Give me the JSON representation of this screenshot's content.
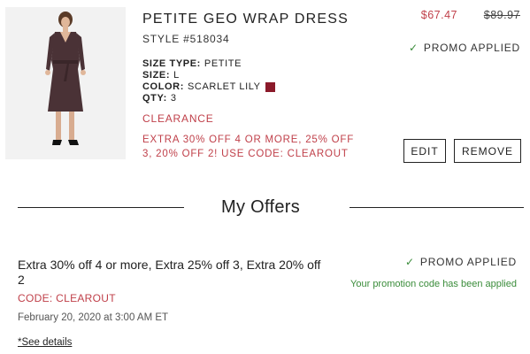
{
  "product": {
    "title": "PETITE GEO WRAP DRESS",
    "style": "STYLE #518034",
    "attributes": [
      {
        "key": "SIZE TYPE:",
        "value": "PETITE"
      },
      {
        "key": "SIZE:",
        "value": "L"
      },
      {
        "key": "COLOR:",
        "value": "SCARLET LILY"
      },
      {
        "key": "QTY:",
        "value": "3"
      }
    ],
    "color_swatch": "#8b1a2a",
    "clearance_label": "CLEARANCE",
    "promo_text": "EXTRA 30% OFF 4 OR MORE, 25% OFF 3, 20% OFF 2! USE CODE: CLEAROUT",
    "sale_price": "$67.47",
    "original_price": "$89.97",
    "promo_applied": "PROMO APPLIED",
    "edit_label": "EDIT",
    "remove_label": "REMOVE",
    "image_icon": "dress-photo"
  },
  "offers": {
    "section_title": "My Offers",
    "items": [
      {
        "description": "Extra 30% off 4 or more, Extra 25% off 3, Extra 20% off 2",
        "code": "CODE: CLEAROUT",
        "date": "February 20, 2020 at 3:00 AM ET",
        "see_details": "*See details",
        "status": "PROMO APPLIED",
        "status_message": "Your promotion code has been applied"
      }
    ]
  },
  "colors": {
    "accent_red": "#c0404a",
    "success_green": "#3a8c3a"
  }
}
